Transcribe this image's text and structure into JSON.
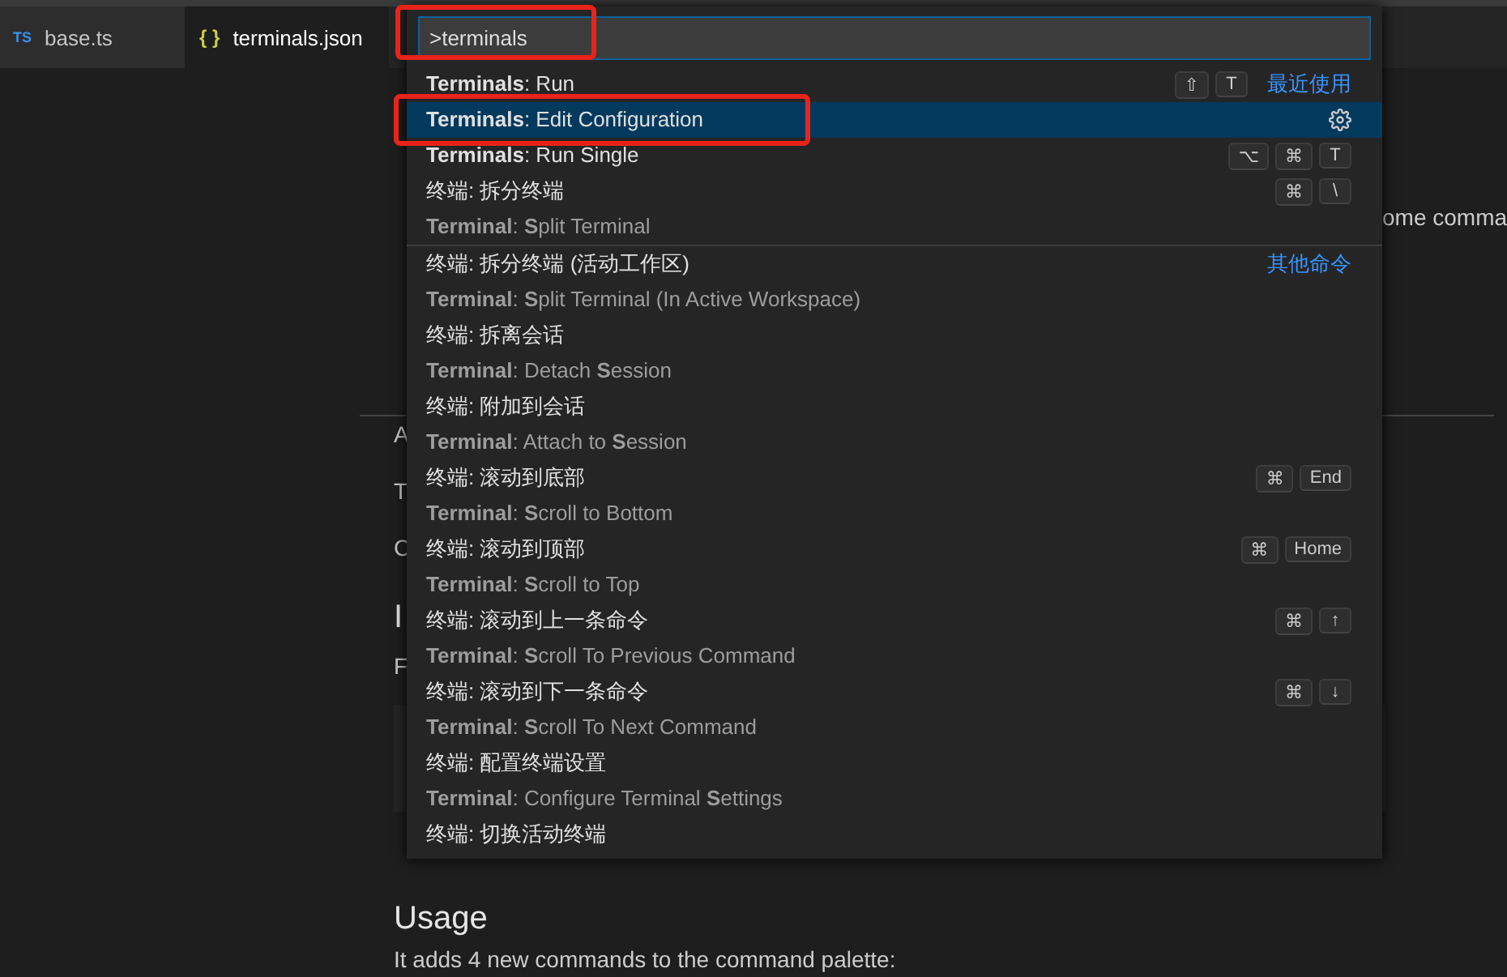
{
  "tabs": [
    {
      "icon": "TS",
      "label": "base.ts",
      "selected": false
    },
    {
      "icon": "{ }",
      "label": "terminals.json",
      "selected": true
    }
  ],
  "document": {
    "fragments": [
      {
        "kind": "right",
        "text": "ome comma"
      },
      {
        "kind": "rule"
      },
      {
        "kind": "left",
        "text": "A"
      },
      {
        "kind": "left",
        "text": "T"
      },
      {
        "kind": "left",
        "text": "C"
      },
      {
        "kind": "heading",
        "text": "I"
      },
      {
        "kind": "left",
        "text": "F"
      },
      {
        "kind": "code"
      },
      {
        "kind": "heading",
        "text": "Usage"
      },
      {
        "kind": "paragraph",
        "text": "It adds 4 new commands to the command palette:"
      }
    ]
  },
  "palette": {
    "value": ">terminals",
    "highlighted": true,
    "items": [
      {
        "label": "**Terminals**: Run",
        "keys": [
          "⇧",
          "T"
        ],
        "tag": "最近使用",
        "selected": false,
        "highlighted": false,
        "separator_above": false
      },
      {
        "label": "**Terminals**: Edit Configuration",
        "gear": true,
        "selected": true,
        "highlighted": true,
        "separator_above": false
      },
      {
        "label": "**Terminals**: Run Single",
        "keys": [
          "⌥",
          "⌘",
          "T"
        ],
        "selected": false,
        "highlighted": false,
        "separator_above": false
      },
      {
        "label": "终端: 拆分终端",
        "detail": "**Terminal**: **S**plit Terminal",
        "keys": [
          "⌘",
          "\\"
        ],
        "selected": false,
        "highlighted": false,
        "separator_above": false
      },
      {
        "label": "终端: 拆分终端 (活动工作区)",
        "detail": "**Terminal**: **S**plit Terminal (In Active Workspace)",
        "tag": "其他命令",
        "selected": false,
        "highlighted": false,
        "separator_above": true
      },
      {
        "label": "终端: 拆离会话",
        "detail": "**Terminal**: Detach **S**ession",
        "selected": false,
        "highlighted": false,
        "separator_above": false
      },
      {
        "label": "终端: 附加到会话",
        "detail": "**Terminal**: Attach to **S**ession",
        "selected": false,
        "highlighted": false,
        "separator_above": false
      },
      {
        "label": "终端: 滚动到底部",
        "detail": "**Terminal**: **S**croll to Bottom",
        "keys": [
          "⌘",
          "End"
        ],
        "selected": false,
        "highlighted": false,
        "separator_above": false
      },
      {
        "label": "终端: 滚动到顶部",
        "detail": "**Terminal**: **S**croll to Top",
        "keys": [
          "⌘",
          "Home"
        ],
        "selected": false,
        "highlighted": false,
        "separator_above": false
      },
      {
        "label": "终端: 滚动到上一条命令",
        "detail": "**Terminal**: **S**croll To Previous Command",
        "keys": [
          "⌘",
          "↑"
        ],
        "selected": false,
        "highlighted": false,
        "separator_above": false
      },
      {
        "label": "终端: 滚动到下一条命令",
        "detail": "**Terminal**: **S**croll To Next Command",
        "keys": [
          "⌘",
          "↓"
        ],
        "selected": false,
        "highlighted": false,
        "separator_above": false
      },
      {
        "label": "终端: 配置终端设置",
        "detail": "**Terminal**: Configure Terminal **S**ettings",
        "selected": false,
        "highlighted": false,
        "separator_above": false
      },
      {
        "label": "终端: 切换活动终端",
        "selected": false,
        "highlighted": false,
        "separator_above": false
      }
    ]
  }
}
